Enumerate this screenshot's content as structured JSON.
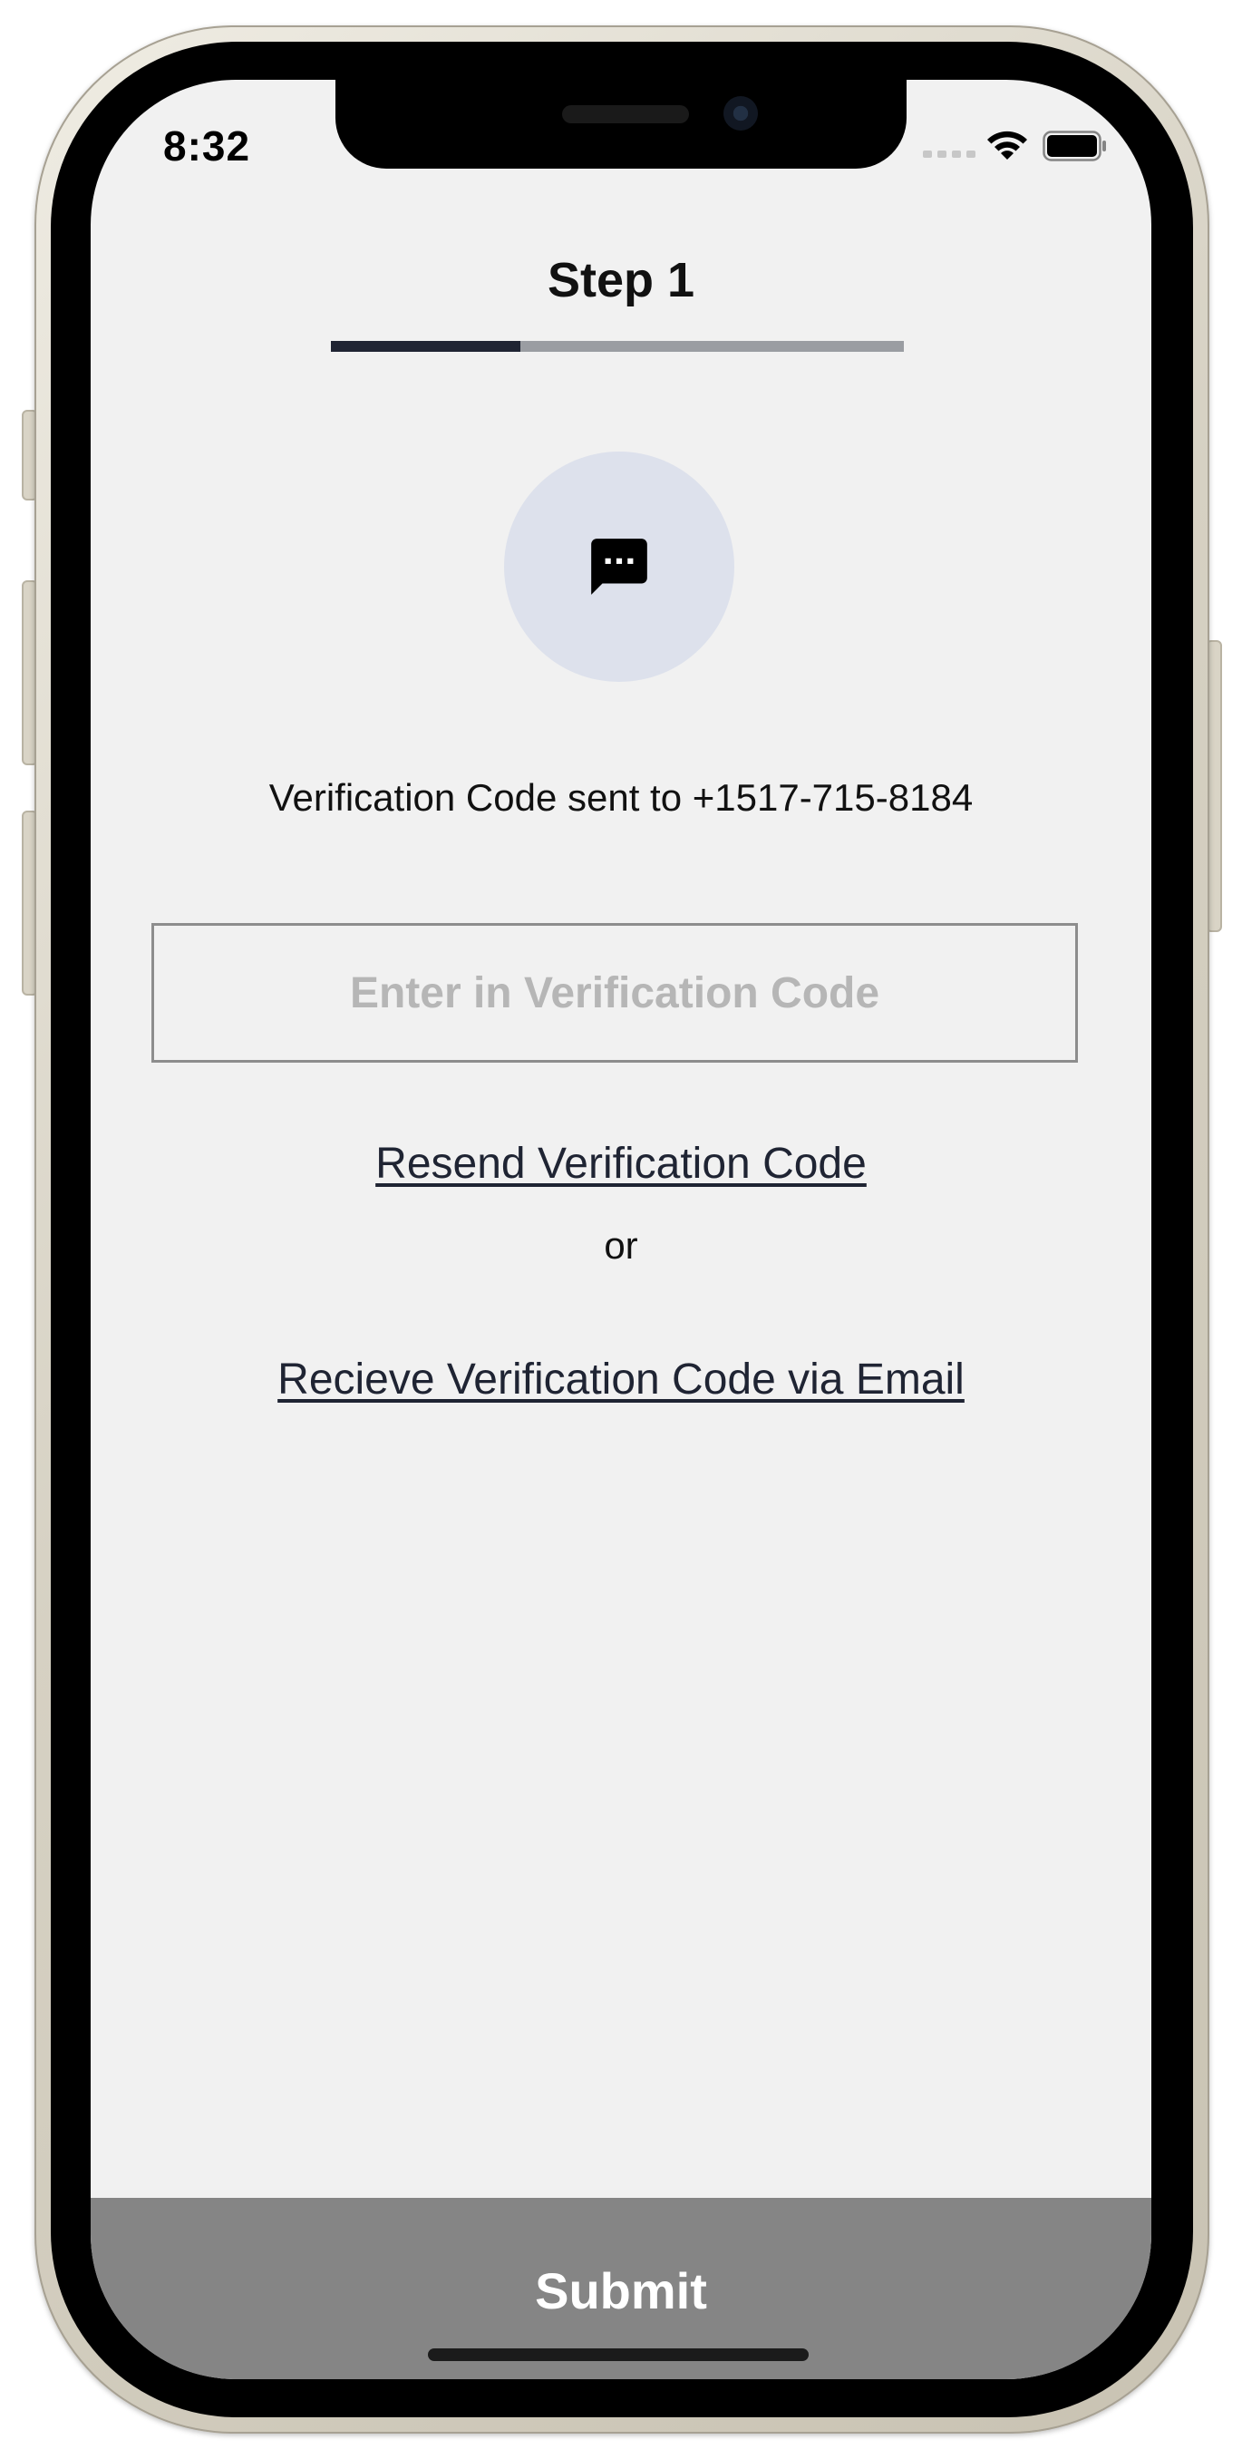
{
  "status_bar": {
    "time": "8:32",
    "icons": [
      "cellular-signal-icon",
      "wifi-icon",
      "battery-icon"
    ]
  },
  "header": {
    "title": "Step 1",
    "progress": 0.33
  },
  "icon": {
    "name": "chat-bubble-icon",
    "circle_color": "#dde1ec"
  },
  "verification": {
    "sent_text": "Verification Code sent to +1517-715-8184",
    "input_placeholder": "Enter in Verification Code",
    "input_value": "",
    "resend_link": "Resend Verification Code",
    "separator": "or",
    "email_link": "Recieve Verification Code via Email"
  },
  "footer": {
    "submit_label": "Submit"
  },
  "colors": {
    "accent": "#1f2433",
    "progress_track": "#9a9da2",
    "submit_background": "#858585",
    "screen_background": "#f1f1f1"
  }
}
